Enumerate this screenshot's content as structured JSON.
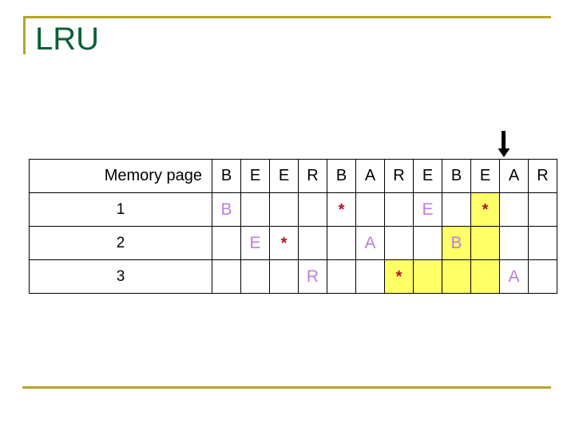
{
  "slide": {
    "title": "LRU",
    "title_color": "#0B5F36",
    "accent_color": "#B8A32B"
  },
  "pointer": {
    "icon": "arrow-down-icon",
    "points_to_column_index": 10,
    "color": "#000000"
  },
  "table": {
    "row_label_header": "Memory page",
    "reference_string": [
      "B",
      "E",
      "E",
      "R",
      "B",
      "A",
      "R",
      "E",
      "B",
      "E",
      "A",
      "R"
    ],
    "frame_labels": [
      "1",
      "2",
      "3"
    ],
    "highlight_color": "#FFFF66",
    "letter_color": "#BE7EDC",
    "star_color": "#B5112A",
    "rows": [
      {
        "label": "1",
        "cells": [
          {
            "text": "B",
            "kind": "letter",
            "highlight": false
          },
          {
            "text": "",
            "kind": "empty",
            "highlight": false
          },
          {
            "text": "",
            "kind": "empty",
            "highlight": false
          },
          {
            "text": "",
            "kind": "empty",
            "highlight": false
          },
          {
            "text": "*",
            "kind": "star",
            "highlight": false
          },
          {
            "text": "",
            "kind": "empty",
            "highlight": false
          },
          {
            "text": "",
            "kind": "empty",
            "highlight": false
          },
          {
            "text": "E",
            "kind": "letter",
            "highlight": false
          },
          {
            "text": "",
            "kind": "empty",
            "highlight": false
          },
          {
            "text": "*",
            "kind": "star",
            "highlight": true
          },
          {
            "text": "",
            "kind": "empty",
            "highlight": false
          },
          {
            "text": "",
            "kind": "empty",
            "highlight": false
          }
        ]
      },
      {
        "label": "2",
        "cells": [
          {
            "text": "",
            "kind": "empty",
            "highlight": false
          },
          {
            "text": "E",
            "kind": "letter",
            "highlight": false
          },
          {
            "text": "*",
            "kind": "star",
            "highlight": false
          },
          {
            "text": "",
            "kind": "empty",
            "highlight": false
          },
          {
            "text": "",
            "kind": "empty",
            "highlight": false
          },
          {
            "text": "A",
            "kind": "letter",
            "highlight": false
          },
          {
            "text": "",
            "kind": "empty",
            "highlight": false
          },
          {
            "text": "",
            "kind": "empty",
            "highlight": false
          },
          {
            "text": "B",
            "kind": "letter",
            "highlight": true
          },
          {
            "text": "",
            "kind": "empty",
            "highlight": true
          },
          {
            "text": "",
            "kind": "empty",
            "highlight": false
          },
          {
            "text": "",
            "kind": "empty",
            "highlight": false
          }
        ]
      },
      {
        "label": "3",
        "cells": [
          {
            "text": "",
            "kind": "empty",
            "highlight": false
          },
          {
            "text": "",
            "kind": "empty",
            "highlight": false
          },
          {
            "text": "",
            "kind": "empty",
            "highlight": false
          },
          {
            "text": "R",
            "kind": "letter",
            "highlight": false
          },
          {
            "text": "",
            "kind": "empty",
            "highlight": false
          },
          {
            "text": "",
            "kind": "empty",
            "highlight": false
          },
          {
            "text": "*",
            "kind": "star",
            "highlight": true
          },
          {
            "text": "",
            "kind": "empty",
            "highlight": true
          },
          {
            "text": "",
            "kind": "empty",
            "highlight": true
          },
          {
            "text": "",
            "kind": "empty",
            "highlight": true
          },
          {
            "text": "A",
            "kind": "letter",
            "highlight": false
          },
          {
            "text": "",
            "kind": "empty",
            "highlight": false
          }
        ]
      }
    ]
  }
}
